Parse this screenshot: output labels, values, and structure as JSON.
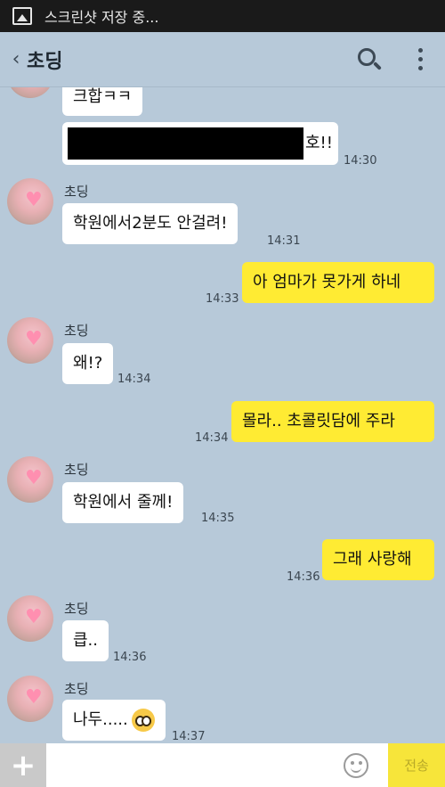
{
  "status_bar": {
    "text": "스크린샷 저장 중..."
  },
  "header": {
    "back": "‹",
    "title": "초딩"
  },
  "messages": [
    {
      "text": "크합ㅋㅋ"
    },
    {
      "text_suffix": "호!!",
      "time": "14:30"
    },
    {
      "name": "초딩",
      "text": "학원에서2분도 안걸려!",
      "time": "14:31"
    },
    {
      "text": "아 엄마가 못가게 하네",
      "time": "14:33"
    },
    {
      "name": "초딩",
      "text": "왜!?",
      "time": "14:34"
    },
    {
      "text": "몰라..  초콜릿담에 주라",
      "time": "14:34"
    },
    {
      "name": "초딩",
      "text": "학원에서 줄께!",
      "time": "14:35"
    },
    {
      "text": "그래 사랑해",
      "time": "14:36"
    },
    {
      "name": "초딩",
      "text": "큽..",
      "time": "14:36"
    },
    {
      "name": "초딩",
      "text": "나두.....",
      "time": "14:37"
    }
  ],
  "input_bar": {
    "plus": "+",
    "send": "전송"
  }
}
